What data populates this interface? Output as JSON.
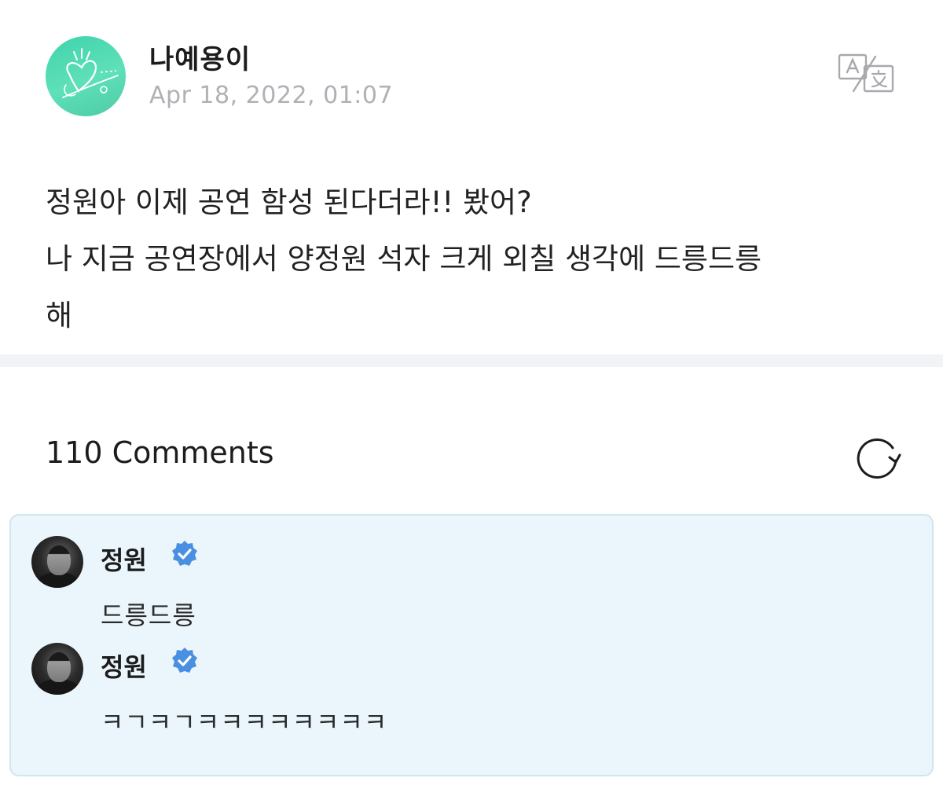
{
  "post": {
    "author": "나예용이",
    "date": "Apr 18, 2022, 01:07",
    "body": "정원아 이제 공연 함성 된다더라!! 봤어?\n나 지금 공연장에서 양정원 석자 크게 외칠 생각에 드릉드릉\n해",
    "translate_icon": "translate-icon",
    "avatar_icon": "heart-doodle-avatar"
  },
  "comments": {
    "count_label": "110 Comments",
    "refresh_icon": "refresh-icon",
    "items": [
      {
        "name": "정원",
        "verified": true,
        "text": "드릉드릉"
      },
      {
        "name": "정원",
        "verified": true,
        "text": "ㅋㄱㅋㄱㅋㅋㅋㅋㅋㅋㅋㅋ"
      }
    ]
  },
  "colors": {
    "accent_verified": "#4a90e2",
    "comment_bg": "#eaf6fc",
    "avatar_green": "#4fd6b0",
    "date_gray": "#b0b0b6"
  }
}
